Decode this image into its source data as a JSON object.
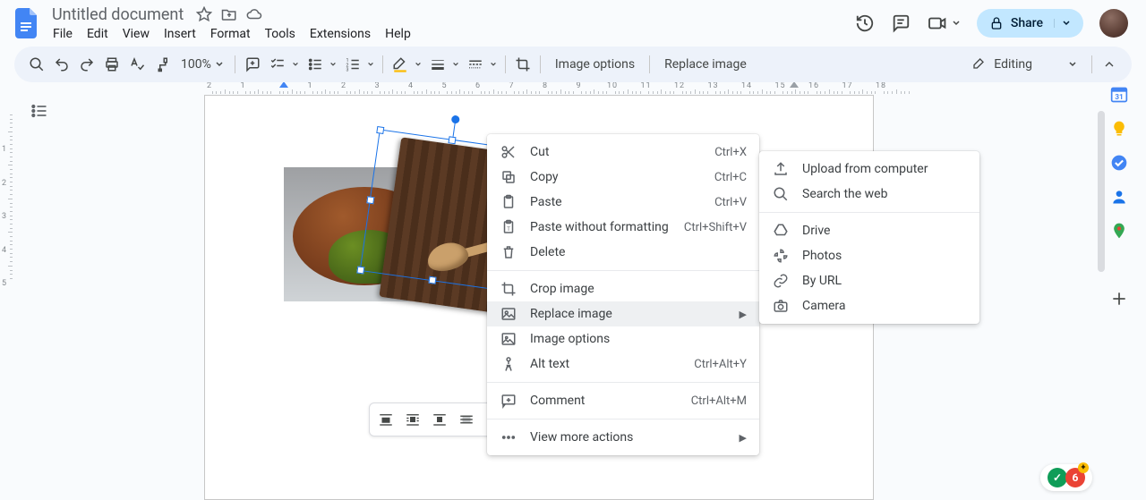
{
  "header": {
    "title": "Untitled document",
    "menu": [
      "File",
      "Edit",
      "View",
      "Insert",
      "Format",
      "Tools",
      "Extensions",
      "Help"
    ],
    "share_label": "Share"
  },
  "toolbar": {
    "zoom": "100%",
    "image_options": "Image options",
    "replace_image": "Replace image",
    "editing": "Editing"
  },
  "context_menu": {
    "items": [
      {
        "icon": "cut",
        "label": "Cut",
        "shortcut": "Ctrl+X"
      },
      {
        "icon": "copy",
        "label": "Copy",
        "shortcut": "Ctrl+C"
      },
      {
        "icon": "paste",
        "label": "Paste",
        "shortcut": "Ctrl+V"
      },
      {
        "icon": "paste-plain",
        "label": "Paste without formatting",
        "shortcut": "Ctrl+Shift+V"
      },
      {
        "icon": "delete",
        "label": "Delete"
      },
      {
        "sep": true
      },
      {
        "icon": "crop",
        "label": "Crop image"
      },
      {
        "icon": "image",
        "label": "Replace image",
        "submenu": true,
        "highlighted": true
      },
      {
        "icon": "tune",
        "label": "Image options"
      },
      {
        "icon": "alt",
        "label": "Alt text",
        "shortcut": "Ctrl+Alt+Y"
      },
      {
        "sep": true
      },
      {
        "icon": "comment",
        "label": "Comment",
        "shortcut": "Ctrl+Alt+M"
      },
      {
        "sep": true
      },
      {
        "icon": "more",
        "label": "View more actions",
        "submenu": true
      }
    ]
  },
  "submenu": {
    "items": [
      {
        "icon": "upload",
        "label": "Upload from computer"
      },
      {
        "icon": "search",
        "label": "Search the web"
      },
      {
        "sep": true
      },
      {
        "icon": "drive",
        "label": "Drive"
      },
      {
        "icon": "photos",
        "label": "Photos"
      },
      {
        "icon": "link",
        "label": "By URL"
      },
      {
        "icon": "camera",
        "label": "Camera"
      }
    ]
  },
  "ruler_h": [
    2,
    1,
    "",
    1,
    2,
    3,
    4,
    5,
    6,
    7,
    8,
    9,
    10,
    11,
    12,
    13,
    14,
    15,
    16,
    17,
    18
  ],
  "ruler_v": [
    1,
    2,
    3,
    4,
    5
  ]
}
